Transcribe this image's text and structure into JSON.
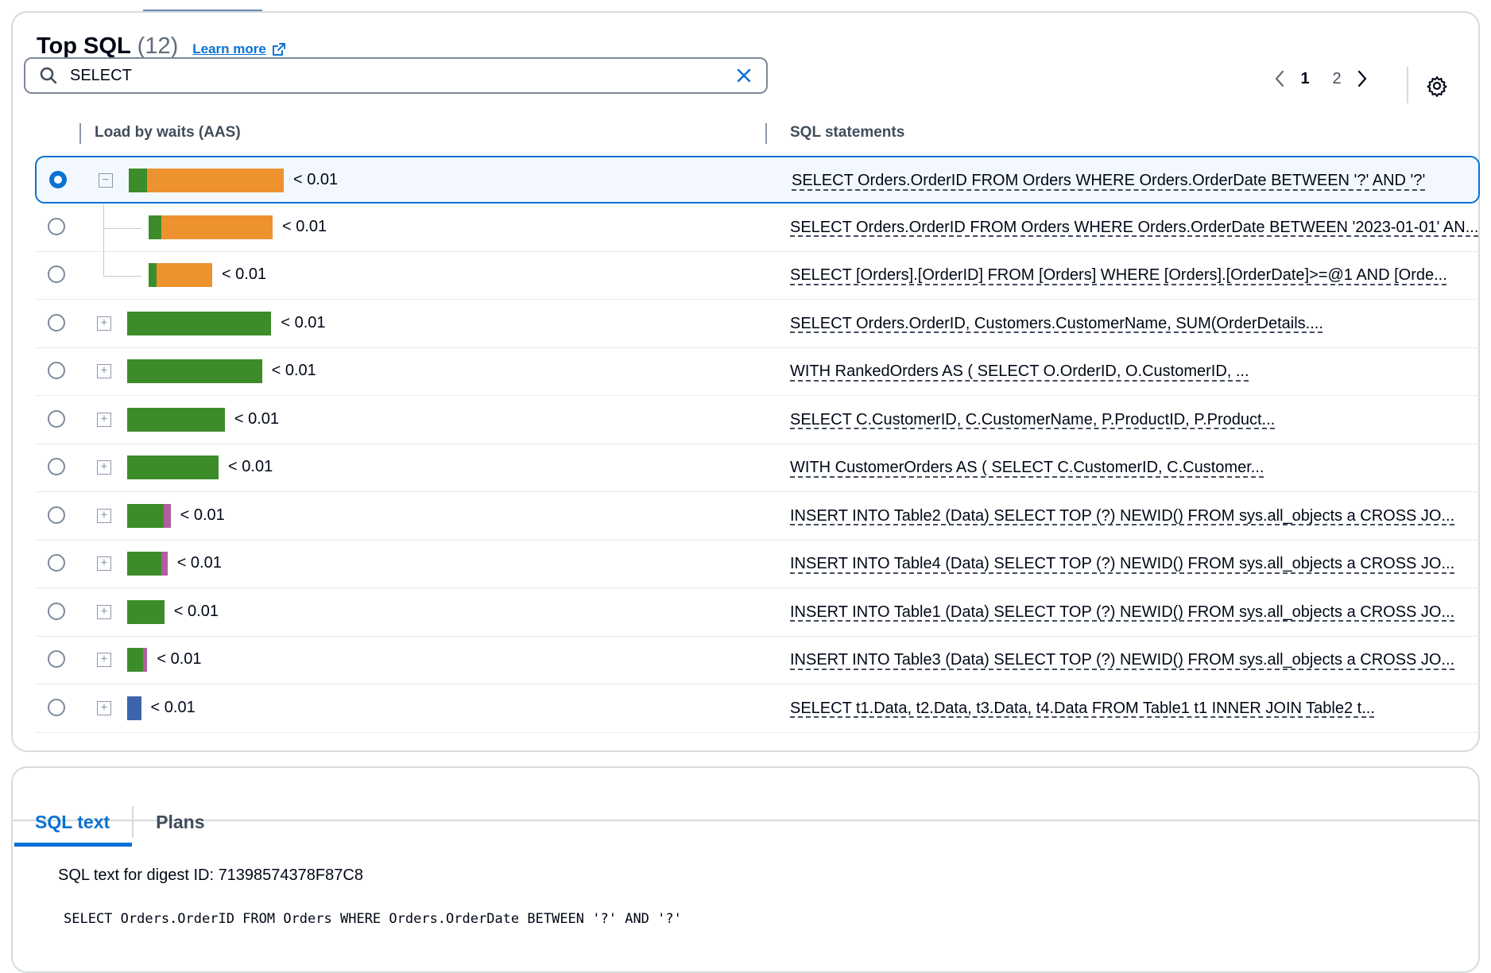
{
  "header": {
    "title": "Top SQL",
    "count": "(12)",
    "learn_more": "Learn more"
  },
  "search": {
    "value": "SELECT"
  },
  "pagination": {
    "pages": [
      "1",
      "2"
    ],
    "current": "1"
  },
  "table": {
    "columns": {
      "load": "Load by waits (AAS)",
      "sql": "SQL statements"
    },
    "colors": {
      "cpu": "#3d8c2a",
      "io": "#ee9230",
      "other": "#b15ea1",
      "lock": "#3d64ae"
    },
    "rows": [
      {
        "load": "< 0.01",
        "segments": [
          {
            "c": "cpu",
            "v": 0.12
          },
          {
            "c": "io",
            "v": 0.88
          }
        ],
        "scale": 1.0,
        "sql": "SELECT Orders.OrderID FROM Orders WHERE Orders.OrderDate BETWEEN '?' AND '?'",
        "selected": true,
        "expand": "minus"
      },
      {
        "load": "< 0.01",
        "segments": [
          {
            "c": "cpu",
            "v": 0.1
          },
          {
            "c": "io",
            "v": 0.9
          }
        ],
        "scale": 0.8,
        "sql": "SELECT Orders.OrderID FROM Orders WHERE Orders.OrderDate BETWEEN '2023-01-01' AN...",
        "selected": false,
        "expand": "child"
      },
      {
        "load": "< 0.01",
        "segments": [
          {
            "c": "cpu",
            "v": 0.12
          },
          {
            "c": "io",
            "v": 0.88
          }
        ],
        "scale": 0.41,
        "sql": "SELECT [Orders].[OrderID] FROM [Orders] WHERE [Orders].[OrderDate]>=@1 AND [Orde...",
        "selected": false,
        "expand": "child-last"
      },
      {
        "load": "< 0.01",
        "segments": [
          {
            "c": "cpu",
            "v": 1.0
          }
        ],
        "scale": 0.93,
        "sql": "SELECT Orders.OrderID, Customers.CustomerName, SUM(OrderDetails....",
        "selected": false,
        "expand": "plus"
      },
      {
        "load": "< 0.01",
        "segments": [
          {
            "c": "cpu",
            "v": 1.0
          }
        ],
        "scale": 0.87,
        "sql": "WITH RankedOrders AS ( SELECT O.OrderID, O.CustomerID, ...",
        "selected": false,
        "expand": "plus"
      },
      {
        "load": "< 0.01",
        "segments": [
          {
            "c": "cpu",
            "v": 1.0
          }
        ],
        "scale": 0.63,
        "sql": "SELECT C.CustomerID, C.CustomerName, P.ProductID, P.Product...",
        "selected": false,
        "expand": "plus"
      },
      {
        "load": "< 0.01",
        "segments": [
          {
            "c": "cpu",
            "v": 1.0
          }
        ],
        "scale": 0.59,
        "sql": "WITH CustomerOrders AS ( SELECT C.CustomerID, C.Customer...",
        "selected": false,
        "expand": "plus"
      },
      {
        "load": "< 0.01",
        "segments": [
          {
            "c": "cpu",
            "v": 0.85
          },
          {
            "c": "other",
            "v": 0.15
          }
        ],
        "scale": 0.28,
        "sql": "INSERT INTO Table2 (Data) SELECT TOP (?) NEWID() FROM sys.all_objects a CROSS JO...",
        "selected": false,
        "expand": "plus"
      },
      {
        "load": "< 0.01",
        "segments": [
          {
            "c": "cpu",
            "v": 0.85
          },
          {
            "c": "other",
            "v": 0.15
          }
        ],
        "scale": 0.26,
        "sql": "INSERT INTO Table4 (Data) SELECT TOP (?) NEWID() FROM sys.all_objects a CROSS JO...",
        "selected": false,
        "expand": "plus"
      },
      {
        "load": "< 0.01",
        "segments": [
          {
            "c": "cpu",
            "v": 1.0
          }
        ],
        "scale": 0.24,
        "sql": "INSERT INTO Table1 (Data) SELECT TOP (?) NEWID() FROM sys.all_objects a CROSS JO...",
        "selected": false,
        "expand": "plus"
      },
      {
        "load": "< 0.01",
        "segments": [
          {
            "c": "cpu",
            "v": 0.8
          },
          {
            "c": "other",
            "v": 0.2
          }
        ],
        "scale": 0.13,
        "sql": "INSERT INTO Table3 (Data) SELECT TOP (?) NEWID() FROM sys.all_objects a CROSS JO...",
        "selected": false,
        "expand": "plus"
      },
      {
        "load": "< 0.01",
        "segments": [
          {
            "c": "lock",
            "v": 1.0
          }
        ],
        "scale": 0.09,
        "sql": "SELECT t1.Data, t2.Data, t3.Data, t4.Data FROM Table1 t1 INNER JOIN Table2 t...",
        "selected": false,
        "expand": "plus"
      }
    ]
  },
  "details": {
    "tabs": [
      "SQL text",
      "Plans"
    ],
    "active_tab": "SQL text",
    "digest_label": "SQL text for digest ID: 71398574378F87C8",
    "sql_text": "SELECT Orders.OrderID FROM Orders WHERE Orders.OrderDate BETWEEN '?' AND '?'"
  }
}
